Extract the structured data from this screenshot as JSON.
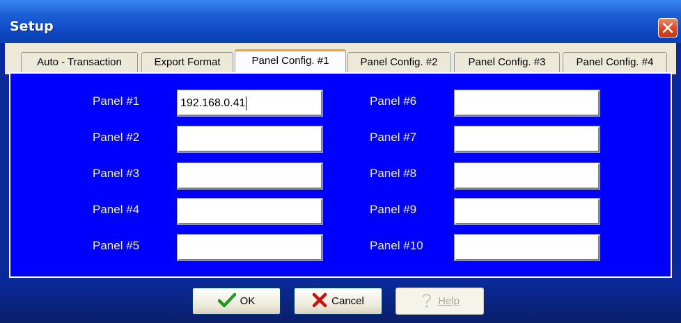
{
  "window": {
    "title": "Setup"
  },
  "tabs": [
    {
      "label": "Auto - Transaction",
      "active": false
    },
    {
      "label": "Export Format",
      "active": false
    },
    {
      "label": "Panel Config. #1",
      "active": true
    },
    {
      "label": "Panel Config. #2",
      "active": false
    },
    {
      "label": "Panel Config. #3",
      "active": false
    },
    {
      "label": "Panel Config. #4",
      "active": false
    }
  ],
  "panels": [
    {
      "label": "Panel #1",
      "value": "192.168.0.41"
    },
    {
      "label": "Panel #2",
      "value": ""
    },
    {
      "label": "Panel #3",
      "value": ""
    },
    {
      "label": "Panel #4",
      "value": ""
    },
    {
      "label": "Panel #5",
      "value": ""
    },
    {
      "label": "Panel #6",
      "value": ""
    },
    {
      "label": "Panel #7",
      "value": ""
    },
    {
      "label": "Panel #8",
      "value": ""
    },
    {
      "label": "Panel #9",
      "value": ""
    },
    {
      "label": "Panel #10",
      "value": ""
    }
  ],
  "buttons": {
    "ok": {
      "label": "OK",
      "icon": "checkmark-icon"
    },
    "cancel": {
      "label": "Cancel",
      "icon": "x-icon"
    },
    "help": {
      "label": "Help",
      "icon": "question-icon",
      "enabled": false
    }
  },
  "colors": {
    "panel_bg": "#0000ff",
    "label_text": "#f2f2a0",
    "active_tab_accent": "#e6a23a"
  }
}
